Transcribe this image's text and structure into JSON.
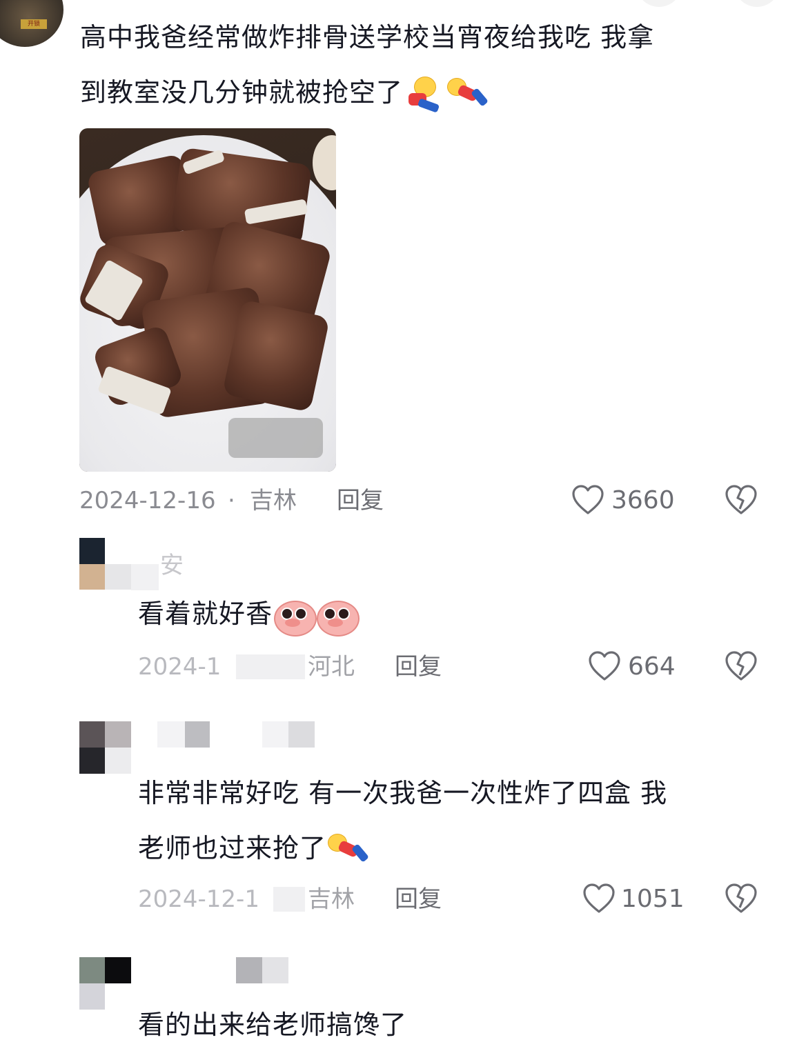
{
  "comments": [
    {
      "text_line1": "高中我爸经常做炸排骨送学校当宵夜给我吃 我拿",
      "text_line2": "到教室没几分钟就被抢空了",
      "emojis": [
        "crying-laughing-man-emoji",
        "falling-man-emoji"
      ],
      "date": "2024-12-16",
      "location": "吉林",
      "reply_label": "回复",
      "likes": "3660"
    },
    {
      "username_fragment": "安",
      "text": "看着就好香",
      "emojis": [
        "pig-emoji",
        "pig-emoji"
      ],
      "date": "2024-1",
      "location": "河北",
      "reply_label": "回复",
      "likes": "664"
    },
    {
      "text_line1": "非常非常好吃 有一次我爸一次性炸了四盒 我",
      "text_line2": "老师也过来抢了",
      "emojis": [
        "falling-man-emoji"
      ],
      "date": "2024-12-1",
      "location": "吉林",
      "reply_label": "回复",
      "likes": "1051"
    },
    {
      "text": "看的出来给老师搞馋了"
    }
  ],
  "colors": {
    "text": "#161823",
    "meta": "#8a8b91",
    "icon": "#6b6c72"
  }
}
